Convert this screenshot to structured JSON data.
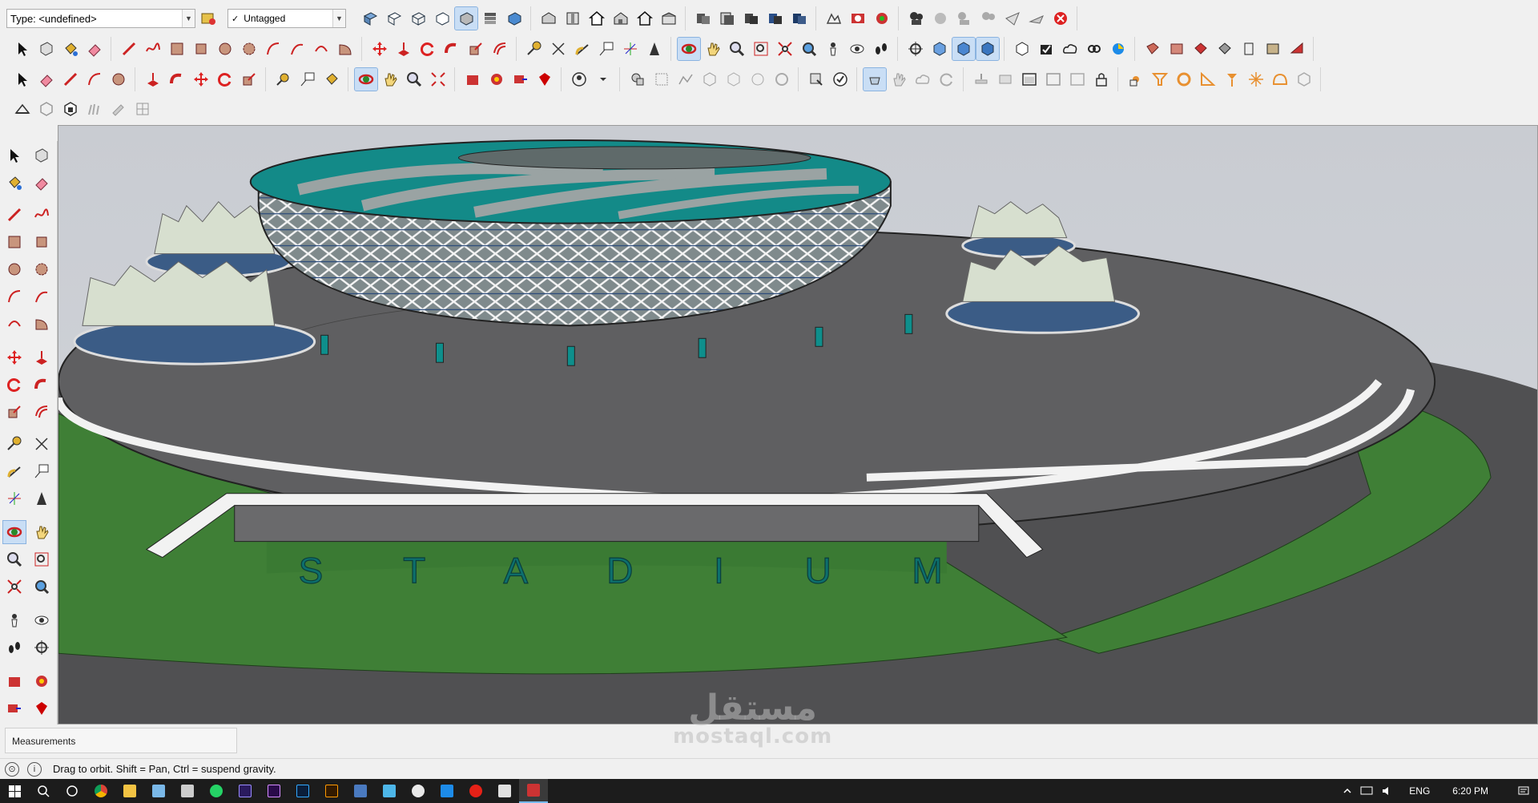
{
  "toolbar": {
    "type_combo": "Type: <undefined>",
    "tag_combo": "Untagged",
    "tag_check": "✓"
  },
  "viewport": {
    "sign_text": "S T A D I U M"
  },
  "measurements": {
    "label": "Measurements"
  },
  "status": {
    "hint": "Drag to orbit. Shift = Pan, Ctrl = suspend gravity."
  },
  "taskbar": {
    "language": "ENG",
    "time": "6:20 PM"
  },
  "watermark": {
    "line1": "مستقل",
    "line2": "mostaql.com"
  },
  "colors": {
    "ground": "#5a5a5c",
    "grass": "#3f7f36",
    "roof": "#138a88",
    "accent": "#d22b2b"
  }
}
